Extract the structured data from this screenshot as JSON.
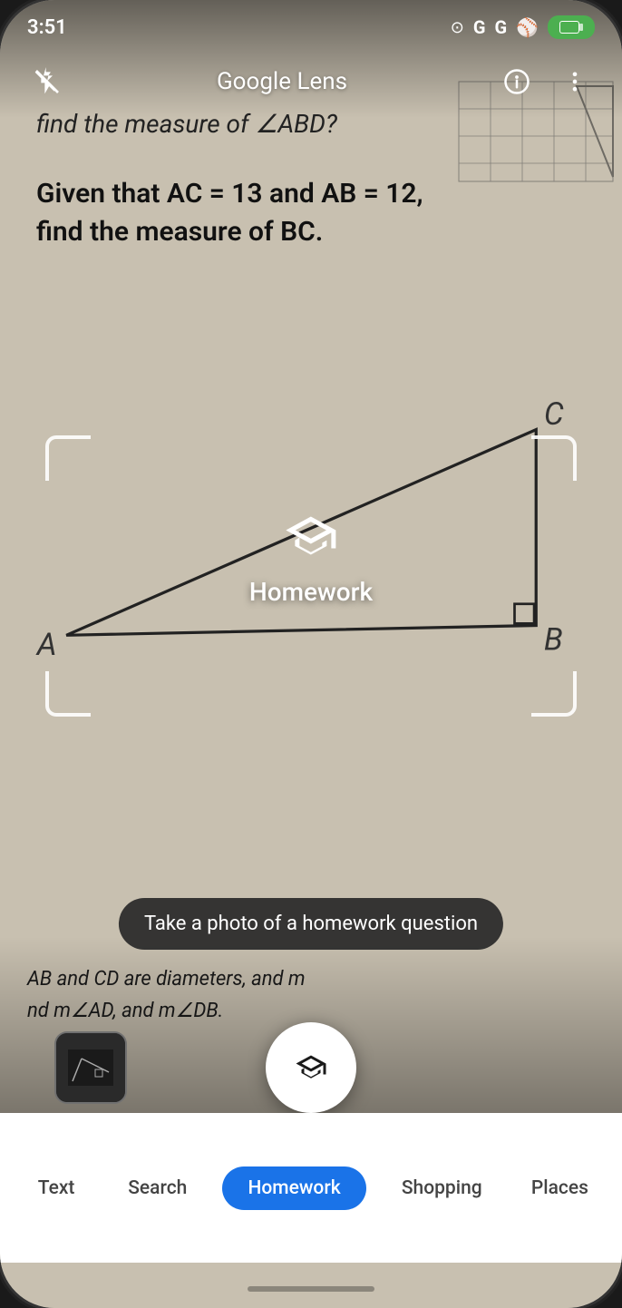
{
  "status_bar": {
    "time": "3:51",
    "icons": [
      "circle-dot",
      "G",
      "G",
      "tennis-ball"
    ],
    "battery_label": "□"
  },
  "top_bar": {
    "title": "Google Lens",
    "flash_icon": "flash-off",
    "info_icon": "info",
    "more_icon": "more-vert"
  },
  "worksheet": {
    "line1": "find the measure of ∠ABD?",
    "line2": "Given that AC = 13 and AB = 12,",
    "line3": "find the measure of BC.",
    "bottom1": "AB and CD are diameters, and m",
    "bottom2": "nd m∠AD, and m∠DB."
  },
  "mode_indicator": {
    "icon": "graduation-cap",
    "label": "Homework"
  },
  "tooltip": {
    "text": "Take a photo of a homework question"
  },
  "shutter": {
    "icon": "graduation-cap"
  },
  "tabs": [
    {
      "id": "text",
      "label": "Text",
      "active": false
    },
    {
      "id": "search",
      "label": "Search",
      "active": false
    },
    {
      "id": "homework",
      "label": "Homework",
      "active": true
    },
    {
      "id": "shopping",
      "label": "Shopping",
      "active": false
    },
    {
      "id": "places",
      "label": "Places",
      "active": false
    }
  ],
  "colors": {
    "active_tab_bg": "#1a73e8",
    "active_tab_text": "#ffffff",
    "inactive_tab_text": "#444444",
    "tab_bar_bg": "#ffffff"
  }
}
